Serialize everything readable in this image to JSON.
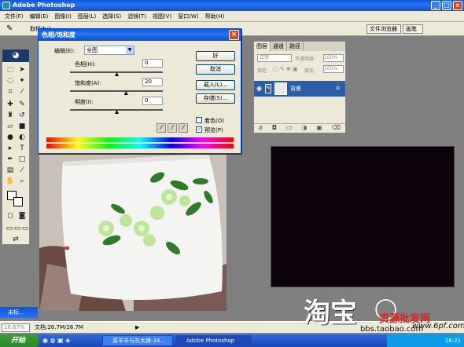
{
  "app": {
    "title": "Adobe Photoshop"
  },
  "menu": [
    "文件(F)",
    "编辑(E)",
    "图像(I)",
    "图层(L)",
    "选择(S)",
    "滤镜(T)",
    "视图(V)",
    "窗口(W)",
    "帮助(H)"
  ],
  "options": {
    "sample_label": "取样大小:",
    "palette_well": [
      "文件浏览器",
      "画笔"
    ]
  },
  "dialog": {
    "title": "色相/饱和度",
    "edit_label": "编辑(E):",
    "edit_value": "全图",
    "hue": {
      "label": "色相(H):",
      "value": "0",
      "level": 0.5
    },
    "saturation": {
      "label": "饱和度(A):",
      "value": "20",
      "level": 0.6
    },
    "lightness": {
      "label": "明度(I):",
      "value": "0",
      "level": 0.5
    },
    "buttons": {
      "ok": "好",
      "cancel": "取消",
      "load": "载入(L)...",
      "save": "存储(S)..."
    },
    "colorize": {
      "label": "着色(O)",
      "checked": false
    },
    "preview": {
      "label": "预览(P)",
      "checked": true
    }
  },
  "layers": {
    "tabs": [
      "图层",
      "通道",
      "路径"
    ],
    "blend_mode": "正常",
    "opacity_label": "不透明度:",
    "opacity": "100%",
    "lock_label": "锁定:",
    "fill_label": "填充:",
    "fill": "100%",
    "layer_name": "背景"
  },
  "minidoc": {
    "label": "未标..."
  },
  "status": {
    "zoom": "16.67%",
    "doc": "文档:26.7M/26.7M"
  },
  "taskbar": {
    "start": "开始",
    "items": [
      "喜羊羊与灰太狼-34...",
      "Adobe Photoshop"
    ],
    "time": "16:21"
  },
  "watermarks": {
    "taobao": "淘宝",
    "site1": "bbs.taobao.com",
    "site2": "资源批发网",
    "site3": "www.6pf.com"
  },
  "colors": {
    "accent": "#0a55de",
    "selection": "#2b5ea6",
    "canvas": "#0b0309"
  }
}
